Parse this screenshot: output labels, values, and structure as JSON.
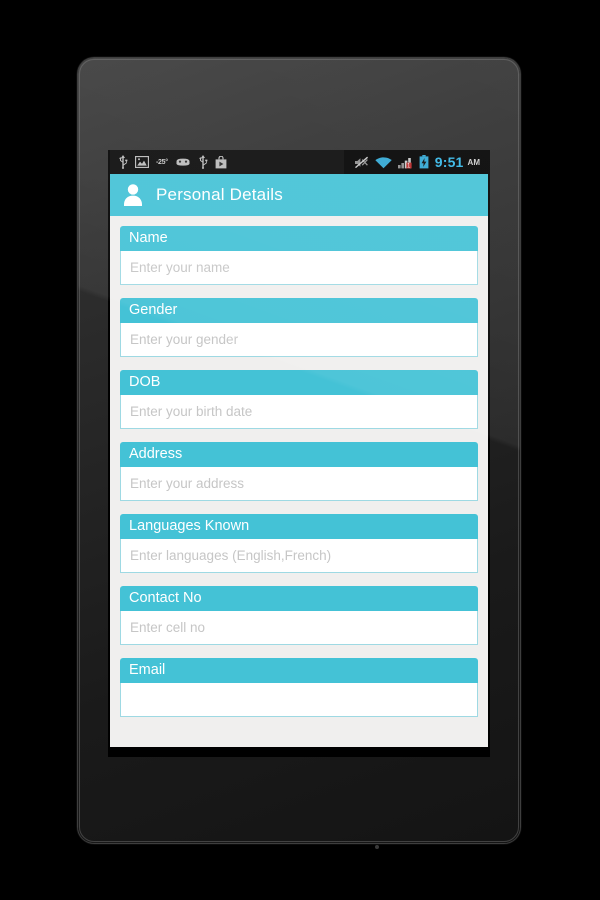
{
  "device": {
    "name": "android-tablet"
  },
  "status_bar": {
    "left_icons": [
      "usb-icon",
      "image-icon",
      "temperature-icon",
      "android-debug-icon",
      "usb-icon",
      "play-store-icon"
    ],
    "temperature": "-25°",
    "right_icons": [
      "mute-icon",
      "wifi-icon",
      "signal-bars-icon",
      "battery-charging-icon"
    ],
    "clock": "9:51",
    "meridiem": "AM"
  },
  "action_bar": {
    "icon": "person-icon",
    "title": "Personal Details"
  },
  "theme": {
    "accent": "#44c2d6",
    "page_background": "#f0efee",
    "input_border": "#9ed9e3",
    "placeholder": "#c6c6c6",
    "clock_color": "#33b5e5"
  },
  "form": {
    "fields": [
      {
        "label": "Name",
        "placeholder": "Enter your name"
      },
      {
        "label": "Gender",
        "placeholder": "Enter your gender"
      },
      {
        "label": "DOB",
        "placeholder": "Enter your birth date"
      },
      {
        "label": "Address",
        "placeholder": "Enter your address"
      },
      {
        "label": "Languages Known",
        "placeholder": "Enter languages (English,French)"
      },
      {
        "label": "Contact No",
        "placeholder": "Enter cell no"
      },
      {
        "label": "Email",
        "placeholder": ""
      }
    ]
  },
  "nav_bar": {
    "buttons": [
      {
        "name": "back-button",
        "icon": "back-arrow-icon"
      },
      {
        "name": "home-button",
        "icon": "home-icon"
      },
      {
        "name": "recents-button",
        "icon": "recents-icon"
      }
    ]
  }
}
